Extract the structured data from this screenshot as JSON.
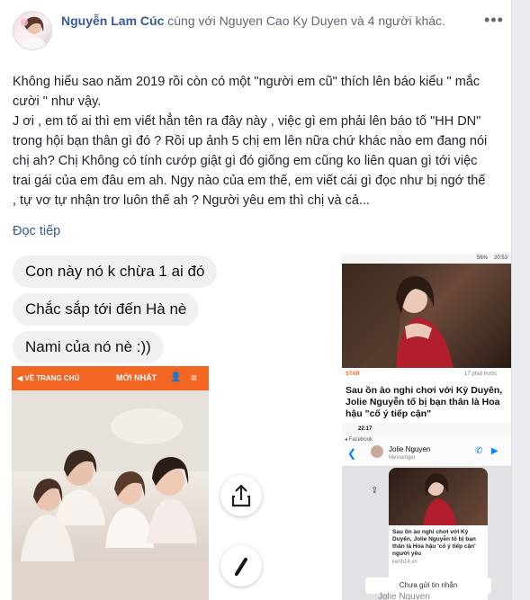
{
  "post": {
    "author": "Nguyễn Lam Cúc",
    "with_text": " cùng với Nguyen Cao Ky Duyen và 4 người khác.",
    "more_icon": "ellipsis-icon",
    "paragraph1": "Không hiểu sao năm 2019 rồi còn có một \"người em cũ\" thích lên báo kiểu \" mắc cười \" như vậy.",
    "paragraph2": "J ơi , em tố ai thì em viết hẳn tên ra đây này , việc gì em phải lên báo tố \"HH DN\" trong hội bạn thân gì đó ? Rồi up ảnh 5 chị em lên nữa chứ khác nào em đang nói chị ah? Chị Không có tính cướp giật gì đó giống em cũng ko liên quan gì tới việc trai gái của em đâu em ah. Ngy nào của em thế, em viết cái gì đọc như bị ngớ thế , tự vơ tự nhận trơ luôn thế ah ? Người yêu em thì chị và cả...",
    "read_more": "Đọc tiếp"
  },
  "chat": {
    "bubble1": "Con này nó k chừa 1 ai đó",
    "bubble2": "Chắc sắp tới đến Hà nè",
    "bubble3": "Nami của nó nè :))",
    "app_nav_home": "VỀ TRANG CHỦ",
    "app_nav_latest": "MỚI NHẤT",
    "share_icon": "share-icon",
    "edit_icon": "pencil-icon"
  },
  "news": {
    "status_time": "20:53",
    "status_battery": "56%",
    "source": "STAR",
    "time_ago": "17 phút trước",
    "headline": "Sau ồn ào nghi chơi với Kỳ Duyên, Jolie Nguyễn tố bị bạn thân là Hoa hậu \"cố ý tiếp cận\""
  },
  "messenger": {
    "time": "22:17",
    "back_label": "Facebook",
    "contact_name": "Jolie Nguyen",
    "contact_sub": "Messenger",
    "shared_headline": "Sau ồn ào nghi chơi với Kỳ Duyên, Jolie Nguyễn tố bị bạn thân là Hoa hậu 'cố ý tiếp cận' người yêu",
    "shared_source": "kenh14.vn",
    "unsent_text": "Chưa gửi tin nhắn",
    "footer_name": "Jolie Nguyen"
  },
  "colors": {
    "link": "#385898",
    "app_orange": "#f26522",
    "messenger_blue": "#0084ff"
  }
}
